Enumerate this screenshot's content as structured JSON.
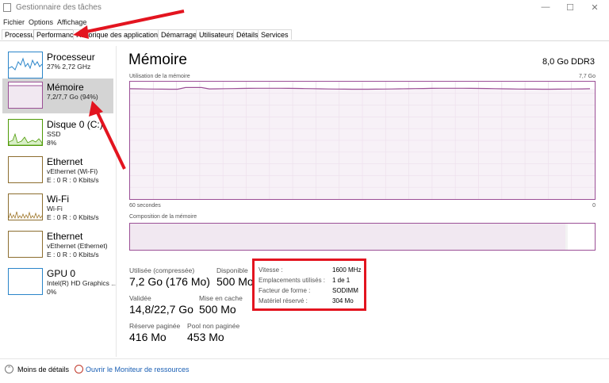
{
  "window": {
    "title": "Gestionnaire des tâches",
    "icons": {
      "app": "task-manager-icon",
      "minimize": "minimize-icon",
      "maximize": "maximize-icon",
      "close": "close-icon"
    }
  },
  "menu": [
    "Fichier",
    "Options",
    "Affichage"
  ],
  "tabs": [
    "Processus",
    "Performance",
    "Historique des applications",
    "Démarrage",
    "Utilisateurs",
    "Détails",
    "Services"
  ],
  "active_tab": "Performance",
  "sidebar": [
    {
      "title": "Processeur",
      "sub": "27% 2,72 GHz",
      "sub2": ""
    },
    {
      "title": "Mémoire",
      "sub": "7,2/7,7 Go (94%)",
      "sub2": ""
    },
    {
      "title": "Disque 0 (C:)",
      "sub": "SSD",
      "sub2": "8%"
    },
    {
      "title": "Ethernet",
      "sub": "vEthernet (Wi-Fi)",
      "sub2": "E : 0 R : 0 Kbits/s"
    },
    {
      "title": "Wi-Fi",
      "sub": "Wi-Fi",
      "sub2": "E : 0 R : 0 Kbits/s"
    },
    {
      "title": "Ethernet",
      "sub": "vEthernet (Ethernet)",
      "sub2": "E : 0 R : 0 Kbits/s"
    },
    {
      "title": "GPU 0",
      "sub": "Intel(R) HD Graphics ...",
      "sub2": "0%"
    }
  ],
  "main": {
    "title": "Mémoire",
    "spec": "8,0 Go DDR3",
    "usage_label": "Utilisation de la mémoire",
    "usage_max": "7,7 Go",
    "time_left": "60 secondes",
    "time_right": "0",
    "composition_label": "Composition de la mémoire",
    "usage_fraction": 0.94,
    "colors": {
      "memory": "#9b4f96",
      "grid": "#e8d6e7",
      "fill": "#f1e8f1",
      "highlight": "#e3141f"
    }
  },
  "stats": {
    "used_label": "Utilisée (compressée)",
    "used_value": "7,2 Go (176 Mo)",
    "available_label": "Disponible",
    "available_value": "500 Mo",
    "committed_label": "Validée",
    "committed_value": "14,8/22,7 Go",
    "cached_label": "Mise en cache",
    "cached_value": "500 Mo",
    "paged_label": "Réserve paginée",
    "paged_value": "416 Mo",
    "nonpaged_label": "Pool non paginée",
    "nonpaged_value": "453 Mo"
  },
  "details": [
    {
      "label": "Vitesse :",
      "value": "1600 MHz"
    },
    {
      "label": "Emplacements utilisés :",
      "value": "1 de 1"
    },
    {
      "label": "Facteur de forme :",
      "value": "SODIMM"
    },
    {
      "label": "Matériel réservé :",
      "value": "304 Mo"
    }
  ],
  "footer": {
    "less_details": "Moins de détails",
    "resource_monitor": "Ouvrir le Moniteur de ressources"
  }
}
